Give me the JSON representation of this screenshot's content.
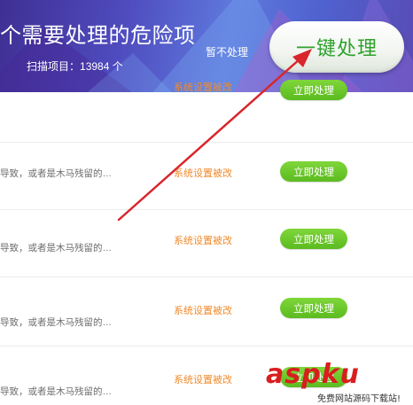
{
  "header": {
    "title": "个需要处理的危险项",
    "scan_label": "扫描项目：",
    "scan_count": "13984",
    "scan_unit": "个",
    "skip_label": "暂不处理",
    "onekey_label": "一键处理"
  },
  "rows": [
    {
      "desc": "",
      "type": "系统设置被改",
      "action": "立即处理"
    },
    {
      "desc": "导致，或者是木马残留的…",
      "type": "系统设置被改",
      "action": "立即处理"
    },
    {
      "desc": "导致，或者是木马残留的…",
      "type": "系统设置被改",
      "action": "立即处理"
    },
    {
      "desc": "导致，或者是木马残留的…",
      "type": "系统设置被改",
      "action": "立即处理"
    },
    {
      "desc": "导致，或者是木马残留的…",
      "type": "系统设置被改",
      "action": "立即处理"
    }
  ],
  "watermark": {
    "logo": "aspku",
    "sub": "免费网站源码下载站!"
  },
  "colors": {
    "header_bg": "#4f4cbf",
    "button_green": "#5bbb1f",
    "type_orange": "#f08a2c",
    "onekey_text": "#2ea12b",
    "arrow_red": "#d9252b"
  }
}
